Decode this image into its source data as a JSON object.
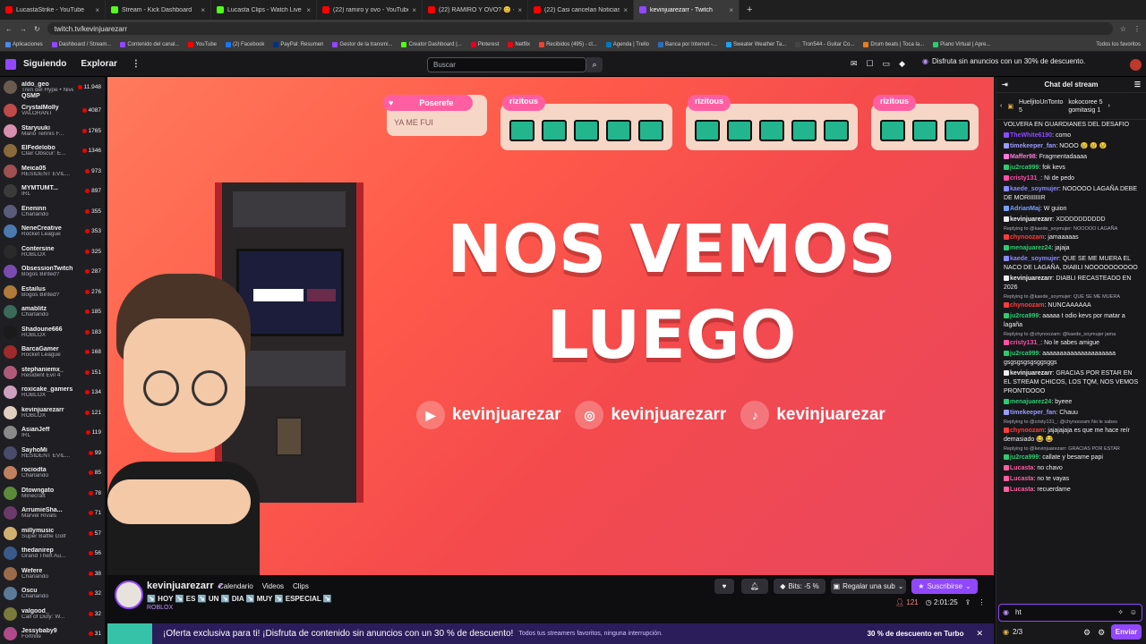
{
  "browser": {
    "tabs": [
      {
        "label": "LucastaStrike - YouTube",
        "color": "#ff0000"
      },
      {
        "label": "Stream - Kick Dashboard",
        "color": "#53fc18"
      },
      {
        "label": "Lucasta Clips - Watch Live on K",
        "color": "#53fc18"
      },
      {
        "label": "(22) ramiro y ovo - YouTube",
        "color": "#ff0000"
      },
      {
        "label": "(22) RAMIRO Y OVO? 😊 - You",
        "color": "#ff0000"
      },
      {
        "label": "(22) Casi cancelan Noticias de V",
        "color": "#ff0000"
      },
      {
        "label": "kevinjuarezarr - Twitch",
        "color": "#9147ff"
      }
    ],
    "url": "twitch.tv/kevinjuarezarr",
    "bookmarks": [
      "Aplicaciones",
      "Dashboard / Stream...",
      "Contenido del canal...",
      "YouTube",
      "(2) Facebook",
      "PayPal: Resumen",
      "Gestor de la transmi...",
      "Creator Dashboard |...",
      "Pinterest",
      "Netflix",
      "Recibidos (495) - cl...",
      "Agenda | Trello",
      "Banca por Internet -...",
      "Sweater Weather Ta...",
      "Tron544 - Guitar Co...",
      "Drum beats | Toca la...",
      "Piano Virtual | Apre..."
    ],
    "all_bookmarks": "Todos los favoritos"
  },
  "twitch_nav": {
    "following": "Siguiendo",
    "browse": "Explorar",
    "search_placeholder": "Buscar",
    "turbo_promo": "Disfruta sin anuncios con un 30% de descuento."
  },
  "sidebar": [
    {
      "name": "aldo_geo",
      "game": "Tren del Hype • Nive",
      "viewers": "11.948",
      "color": "#6b5b4f"
    },
    {
      "name": "QSMP",
      "game": "",
      "viewers": "",
      "color": "#2e8b57"
    },
    {
      "name": "CrystalMolly",
      "game": "VALORANT",
      "viewers": "4087",
      "color": "#c04a4a"
    },
    {
      "name": "Staryuuki",
      "game": "Mario Tennis F...",
      "viewers": "1765",
      "color": "#d98fb0"
    },
    {
      "name": "ElFedelobo",
      "game": "Clair Obscur: E...",
      "viewers": "1346",
      "color": "#8a6a3a"
    },
    {
      "name": "Meica05",
      "game": "RESIDENT EVIL...",
      "viewers": "973",
      "color": "#a05050"
    },
    {
      "name": "MYMTUMT...",
      "game": "IRL",
      "viewers": "897",
      "color": "#3b3b3b"
    },
    {
      "name": "Eneninn",
      "game": "Charlando",
      "viewers": "355",
      "color": "#5a5a7a"
    },
    {
      "name": "NeneCreative",
      "game": "Rocket League",
      "viewers": "353",
      "color": "#4a7ab0"
    },
    {
      "name": "Contersine",
      "game": "ROBLOX",
      "viewers": "325",
      "color": "#2a2a2a"
    },
    {
      "name": "ObsessionTwitch",
      "game": "Bogos Binted?",
      "viewers": "287",
      "color": "#7a4ab0"
    },
    {
      "name": "Estailus",
      "game": "Bogos Binted?",
      "viewers": "276",
      "color": "#b07a3a"
    },
    {
      "name": "amablitz",
      "game": "Charlando",
      "viewers": "185",
      "color": "#3a6a5a"
    },
    {
      "name": "Shadoune666",
      "game": "ROBLOX",
      "viewers": "183",
      "color": "#1a1a1a"
    },
    {
      "name": "BarcaGamer",
      "game": "Rocket League",
      "viewers": "168",
      "color": "#a02a2a"
    },
    {
      "name": "stephaniemx_",
      "game": "Resident Evil 4",
      "viewers": "151",
      "color": "#b05a7a"
    },
    {
      "name": "roxicake_gamers",
      "game": "ROBLOX",
      "viewers": "134",
      "color": "#d0a0c0"
    },
    {
      "name": "kevinjuarezarr",
      "game": "ROBLOX",
      "viewers": "121",
      "color": "#e0d0c0"
    },
    {
      "name": "AsianJeff",
      "game": "IRL",
      "viewers": "119",
      "color": "#8a8a8a"
    },
    {
      "name": "SayhoMi",
      "game": "RESIDENT EVIL...",
      "viewers": "99",
      "color": "#4a4a6a"
    },
    {
      "name": "rociodta",
      "game": "Charlando",
      "viewers": "85",
      "color": "#c08060"
    },
    {
      "name": "Dtowngato",
      "game": "Minecraft",
      "viewers": "78",
      "color": "#5a8a3a"
    },
    {
      "name": "ArrumieSha...",
      "game": "Marvel Rivals",
      "viewers": "71",
      "color": "#6a3a6a"
    },
    {
      "name": "millymusic",
      "game": "Super Battle Golf",
      "viewers": "57",
      "color": "#d0b070"
    },
    {
      "name": "thedanirep",
      "game": "Grand Theft Au...",
      "viewers": "56",
      "color": "#3a5a8a"
    },
    {
      "name": "Wefere",
      "game": "Charlando",
      "viewers": "38",
      "color": "#9a6a4a"
    },
    {
      "name": "Oscu",
      "game": "Charlando",
      "viewers": "32",
      "color": "#5a7a9a"
    },
    {
      "name": "valgood_",
      "game": "Call of Duty: W...",
      "viewers": "32",
      "color": "#7a7a3a"
    },
    {
      "name": "Jessybaby9",
      "game": "Fortnite",
      "viewers": "31",
      "color": "#b04a8a"
    }
  ],
  "stream": {
    "headline_line1": "NOS VEMOS",
    "headline_line2": "LUEGO",
    "top_cards": [
      {
        "user": "Poserefe",
        "message": "YA ME FUI"
      },
      {
        "user": "rizitous",
        "message": ""
      },
      {
        "user": "rizitous",
        "message": ""
      },
      {
        "user": "rizitous",
        "message": ""
      }
    ],
    "socials": [
      {
        "icon": "youtube-icon",
        "handle": "kevinjuarezar"
      },
      {
        "icon": "instagram-icon",
        "handle": "kevinjuarezarr"
      },
      {
        "icon": "tiktok-icon",
        "handle": "kevinjuarezar"
      }
    ]
  },
  "channel": {
    "name": "kevinjuarezarr",
    "tabs": [
      "Calendario",
      "Videos",
      "Clips"
    ],
    "title": "↘️ HOY ↘️ ES ↘️ UN ↘️ DIA ↘️ MUY ↘️ ESPECIAL ↘️",
    "category": "ROBLOX",
    "bits": "Bits: -5 %",
    "gift": "Regalar una sub",
    "subscribe": "Suscribirse",
    "viewers": "121",
    "uptime": "2:01:25"
  },
  "offer": {
    "headline": "¡Oferta exclusiva para ti! ¡Disfruta de contenido sin anuncios con un 30 % de descuento!",
    "sub": "Todos tus streamers favoritos, ninguna interrupción.",
    "cta": "30 % de descuento en Turbo"
  },
  "chat": {
    "title": "Chat del stream",
    "gifters": [
      {
        "name": "HueljitoUnTonto",
        "count": "5"
      },
      {
        "name": "kokocoree",
        "count": "5"
      },
      {
        "name": "gomitasig",
        "count": "1"
      }
    ],
    "lines": [
      {
        "type": "msg",
        "user": "",
        "color": "#efeff1",
        "text": "VOLVERA EN GUARDIANES DEL DESAFIO"
      },
      {
        "type": "msg",
        "user": "TheWhite6190",
        "color": "#8a4cff",
        "text": "como"
      },
      {
        "type": "msg",
        "user": "timekeeper_fan",
        "color": "#9c9cff",
        "text": "NOOO 😢 😢 😢"
      },
      {
        "type": "msg",
        "user": "Maffer98",
        "color": "#ff7ad9",
        "text": "Fragmentadaaaa"
      },
      {
        "type": "msg",
        "user": "ju2rca999",
        "color": "#2ecc71",
        "text": "fok kevs"
      },
      {
        "type": "msg",
        "user": "cristy131_",
        "color": "#ff4fa8",
        "text": "Ni de pedo"
      },
      {
        "type": "msg",
        "user": "kaede_soymujer",
        "color": "#8a8aff",
        "text": "NOOOOO LAGAÑA DEBE DE MORIIIIIIIR"
      },
      {
        "type": "msg",
        "user": "AdrianMaj",
        "color": "#7aa0ff",
        "text": "W guion"
      },
      {
        "type": "msg",
        "user": "kevinjuarezarr",
        "color": "#efeff1",
        "text": "XDDDDDDDDDD"
      },
      {
        "type": "reply",
        "text": "Replying to @kaede_soymujer: NOOOOO LAGAÑA"
      },
      {
        "type": "msg",
        "user": "chynoozam",
        "color": "#ff3b3b",
        "text": "jamaaaaas"
      },
      {
        "type": "msg",
        "user": "menajuarez24",
        "color": "#2ecc71",
        "text": "jajaja"
      },
      {
        "type": "msg",
        "user": "kaede_soymujer",
        "color": "#8a8aff",
        "text": "QUE SE ME MUERA EL NACO DE LAGAÑA, DIABLI NOOOOOOOOOO"
      },
      {
        "type": "msg",
        "user": "kevinjuarezarr",
        "color": "#efeff1",
        "text": "DIABLI RECASTEADO EN 2026"
      },
      {
        "type": "reply",
        "text": "Replying to @kaede_soymujer: QUE SE ME MUERA"
      },
      {
        "type": "msg",
        "user": "chynoozam",
        "color": "#ff3b3b",
        "text": "NUNCAAAAAA"
      },
      {
        "type": "msg",
        "user": "ju2rca999",
        "color": "#2ecc71",
        "text": "aaaaa t odio kevs por matar a lagaña"
      },
      {
        "type": "reply",
        "text": "Replying to @chynoozam: @kaede_soymujer jama"
      },
      {
        "type": "msg",
        "user": "cristy131_",
        "color": "#ff4fa8",
        "text": "No le sabes amigue"
      },
      {
        "type": "msg",
        "user": "ju2rca999",
        "color": "#2ecc71",
        "text": "aaaaaaaaaaaaaaaaaaaaa gsgsgsgsgsggsggs"
      },
      {
        "type": "msg",
        "user": "kevinjuarezarr",
        "color": "#efeff1",
        "text": "GRACIAS POR ESTAR EN EL STREAM CHICOS, LOS TQM, NOS VEMOS PRONTOOOO"
      },
      {
        "type": "msg",
        "user": "menajuarez24",
        "color": "#2ecc71",
        "text": "byeee"
      },
      {
        "type": "msg",
        "user": "timekeeper_fan",
        "color": "#9c9cff",
        "text": "Chauu"
      },
      {
        "type": "reply",
        "text": "Replying to @cristy131_: @chynoozam No le sabes"
      },
      {
        "type": "msg",
        "user": "chynoozam",
        "color": "#ff3b3b",
        "text": "jajajajaja es que me hace reír demasiado 😂 😂"
      },
      {
        "type": "reply",
        "text": "Replying to @kevinjuarezarr: GRACIAS POR ESTAR"
      },
      {
        "type": "msg",
        "user": "ju2rca999",
        "color": "#2ecc71",
        "text": "callate y besame papi"
      },
      {
        "type": "msg",
        "user": "Lucasta",
        "color": "#ff5fa2",
        "text": "no chavo"
      },
      {
        "type": "msg",
        "user": "Lucasta",
        "color": "#ff5fa2",
        "text": "no te vayas"
      },
      {
        "type": "msg",
        "user": "Lucasta",
        "color": "#ff5fa2",
        "text": "recuerdame"
      }
    ],
    "input_value": "ht",
    "points": "2/3",
    "send": "Enviar"
  }
}
